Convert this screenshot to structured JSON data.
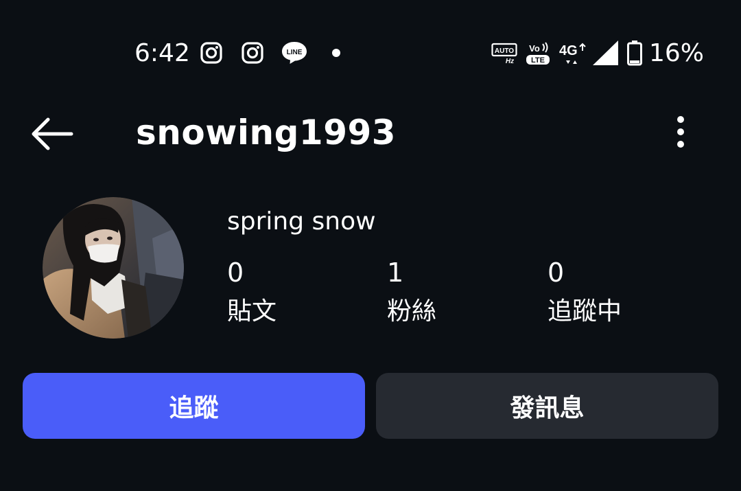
{
  "status_bar": {
    "time": "6:42",
    "notification_icons": [
      "instagram-icon",
      "instagram-icon",
      "line-app-icon"
    ],
    "line_icon_text": "LINE",
    "auto_hz_top": "AUTO",
    "auto_hz_bottom": "Hz",
    "volte_top": "Vo",
    "volte_bottom": "LTE",
    "network": "4G",
    "battery": "16%"
  },
  "app_bar": {
    "username": "snowing1993"
  },
  "profile": {
    "display_name": "spring snow",
    "stats": [
      {
        "count": "0",
        "label": "貼文"
      },
      {
        "count": "1",
        "label": "粉絲"
      },
      {
        "count": "0",
        "label": "追蹤中"
      }
    ]
  },
  "actions": {
    "follow_label": "追蹤",
    "message_label": "發訊息"
  },
  "colors": {
    "background": "#0b0f14",
    "follow_button": "#4a5df9",
    "message_button": "#262a31",
    "text": "#ffffff"
  }
}
